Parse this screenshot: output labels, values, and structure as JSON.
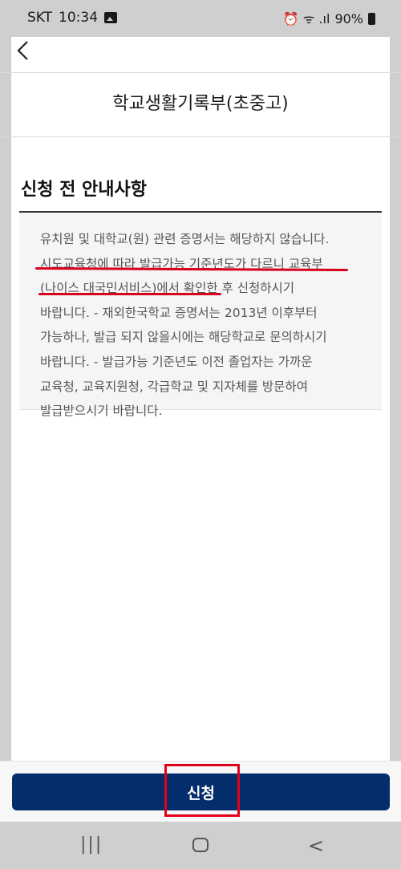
{
  "status_bar": {
    "carrier": "SKT",
    "time": "10:34",
    "signal_text": "⏰ ᯤ .ıl",
    "battery": "90%"
  },
  "header": {
    "back_label": "<",
    "title": "학교생활기록부(초중고)"
  },
  "section": {
    "title": "신청 전 안내사항",
    "notice_lines": [
      "유치원 및 대학교(원) 관련 증명서는 해당하지 않습니다.",
      "시도교육청에 따라 발급가능 기준년도가 다르니 교육부",
      "(나이스 대국민서비스)에서 확인한 후 신청하시기",
      "바랍니다. - 재외한국학교 증명서는 2013년 이후부터",
      "가능하나, 발급 되지 않을시에는 해당학교로 문의하시기",
      "바랍니다. - 발급가능 기준년도 이전 졸업자는 가까운",
      "교육청, 교육지원청, 각급학교 및 지자체를 방문하여",
      "발급받으시기 바랍니다."
    ]
  },
  "actions": {
    "apply_label": "신청"
  },
  "nav": {
    "recent": "|||",
    "back": "<"
  },
  "colors": {
    "button": "#032d6b",
    "annotation": "#e3001b"
  }
}
